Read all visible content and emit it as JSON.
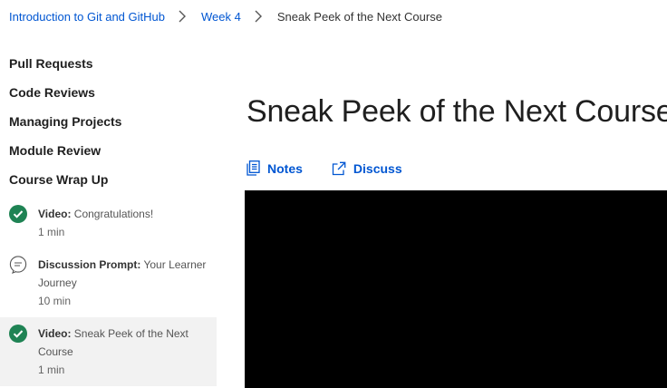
{
  "breadcrumb": {
    "items": [
      {
        "label": "Introduction to Git and GitHub"
      },
      {
        "label": "Week 4"
      }
    ],
    "current": "Sneak Peek of the Next Course"
  },
  "sidebar": {
    "modules": [
      {
        "label": "Pull Requests"
      },
      {
        "label": "Code Reviews"
      },
      {
        "label": "Managing Projects"
      },
      {
        "label": "Module Review"
      },
      {
        "label": "Course Wrap Up"
      }
    ],
    "items": [
      {
        "type": "Video:",
        "title": "Congratulations!",
        "duration": "1 min",
        "icon": "check-circle-icon",
        "status": "completed"
      },
      {
        "type": "Discussion Prompt:",
        "title": "Your Learner Journey",
        "duration": "10 min",
        "icon": "chat-bubble-icon",
        "status": "not-started"
      },
      {
        "type": "Video:",
        "title": "Sneak Peek of the Next Course",
        "duration": "1 min",
        "icon": "check-circle-icon",
        "status": "completed",
        "active": true
      }
    ]
  },
  "main": {
    "title": "Sneak Peek of the Next Course",
    "actions": {
      "notes_label": "Notes",
      "discuss_label": "Discuss"
    }
  },
  "colors": {
    "link": "#0056d2",
    "complete_green": "#1f8354",
    "active_bg": "#f2f2f2",
    "video_bg": "#000000"
  }
}
